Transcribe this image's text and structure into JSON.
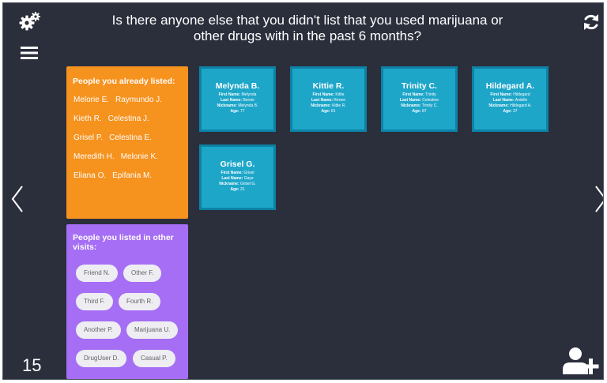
{
  "header": {
    "question": "Is there anyone else that you didn't list that you used marijuana or other drugs with in the past 6 months?"
  },
  "icons": {
    "settings": "gears-icon",
    "menu": "hamburger-menu-icon",
    "refresh": "refresh-icon",
    "prev": "chevron-left-icon",
    "next": "chevron-right-icon",
    "add_person": "add-person-icon"
  },
  "footer": {
    "page_number": "15"
  },
  "listed_panel": {
    "title": "People you already listed:",
    "rows": [
      [
        "Melorie E.",
        "Raymundo J."
      ],
      [
        "Kieth R.",
        "Celestina J."
      ],
      [
        "Grisel P.",
        "Celestina E."
      ],
      [
        "Meredith H.",
        "Melonie K."
      ],
      [
        "Eliana O.",
        "Epifania M."
      ]
    ]
  },
  "other_panel": {
    "title": "People you listed in other visits:",
    "pills": [
      "Friend N.",
      "Other F.",
      "Third F.",
      "Fourth R.",
      "Another P.",
      "Marijuana U.",
      "DrugUser D.",
      "Casual P."
    ]
  },
  "labels": {
    "first": "First Name:",
    "last": "Last Name:",
    "nick": "Nickname:",
    "age": "Age:"
  },
  "cards": [
    {
      "name": "Melynda B.",
      "first": "Melynda",
      "last": "Bernie",
      "nick": "Melynda B.",
      "age": "77"
    },
    {
      "name": "Kittie R.",
      "first": "Kittie",
      "last": "Renee",
      "nick": "Kittie R.",
      "age": "81"
    },
    {
      "name": "Trinity C.",
      "first": "Trinity",
      "last": "Celestine",
      "nick": "Trinity C.",
      "age": "87"
    },
    {
      "name": "Hildegard A.",
      "first": "Hildegard",
      "last": "Ardelle",
      "nick": "Hildegard A.",
      "age": "37"
    },
    {
      "name": "Grisel G.",
      "first": "Grisel",
      "last": "Gaye",
      "nick": "Grisel G.",
      "age": "31"
    }
  ],
  "colors": {
    "background": "#2b2f3c",
    "listed_panel": "#f6921e",
    "other_panel": "#a56ef5",
    "card": "#1ea6c9",
    "card_border": "#0c82a5"
  }
}
